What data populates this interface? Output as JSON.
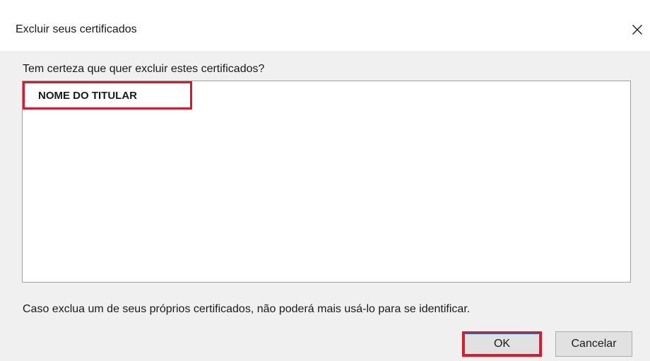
{
  "window": {
    "title": "Excluir seus certificados",
    "close_icon": "close-icon"
  },
  "dialog": {
    "question": "Tem certeza que quer excluir estes certificados?",
    "certificates": [
      {
        "name": "NOME DO TITULAR"
      }
    ],
    "warning": "Caso exclua um de seus próprios certificados, não poderá mais usá-lo para se identificar."
  },
  "buttons": {
    "ok_label": "OK",
    "cancel_label": "Cancelar"
  },
  "colors": {
    "highlight": "#e0162b",
    "dialog_background": "#f0f0f0",
    "button_background": "#e1e1e1"
  }
}
